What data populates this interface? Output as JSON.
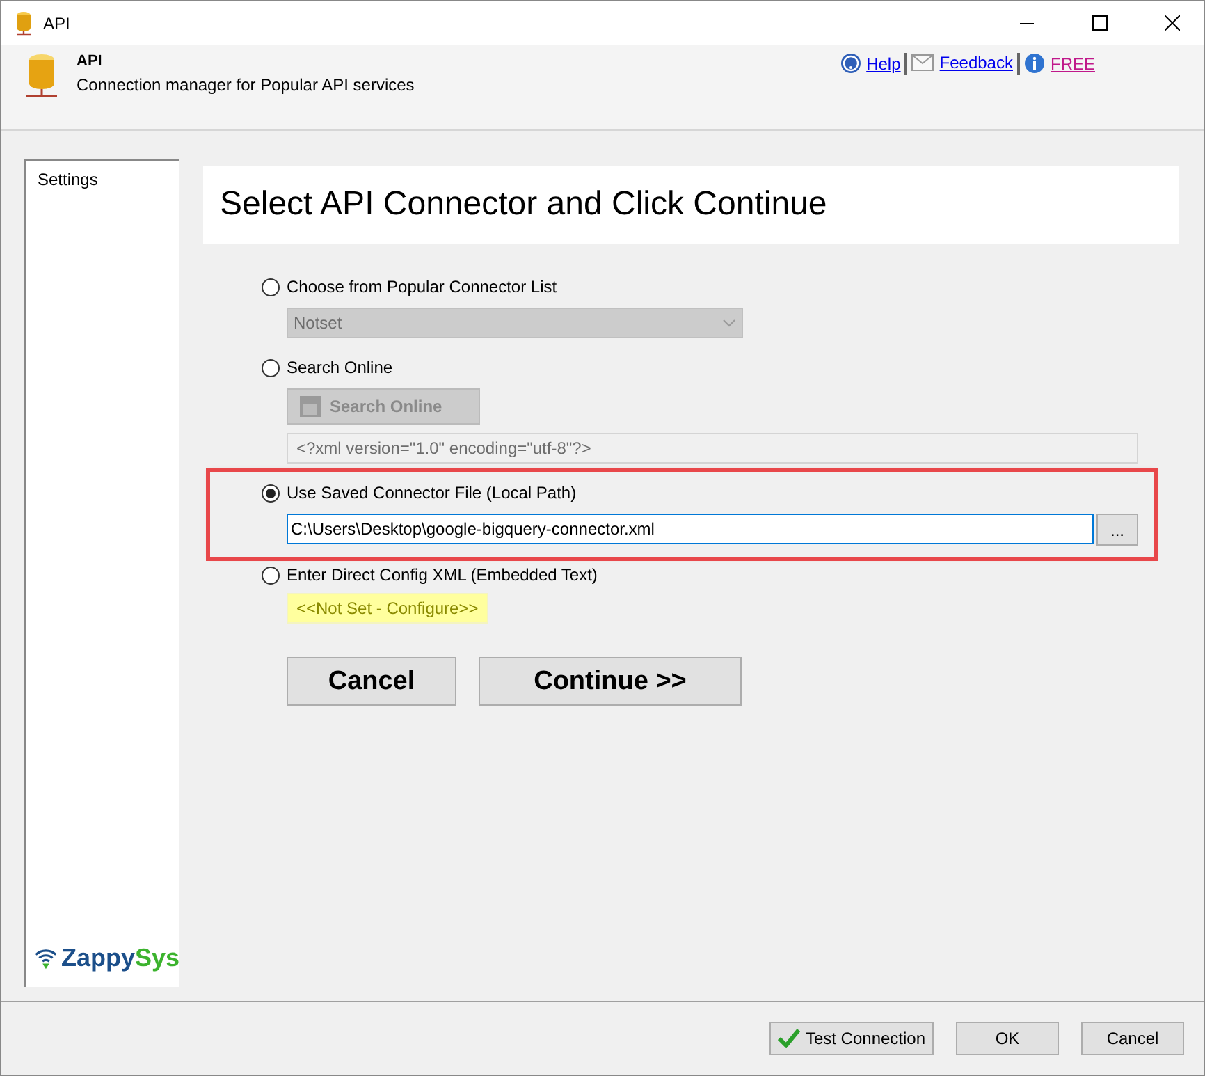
{
  "window": {
    "title": "API"
  },
  "header": {
    "title": "API",
    "subtitle": "Connection manager for Popular API services",
    "links": [
      {
        "kind": "help",
        "label": "Help"
      },
      {
        "kind": "feedback",
        "label": "Feedback"
      },
      {
        "kind": "info",
        "label": "FREE"
      }
    ]
  },
  "sidebar": {
    "items": [
      {
        "label": "Settings",
        "selected": false
      }
    ],
    "logo": {
      "text": "Zappy",
      "accent": "Sys"
    }
  },
  "heading": "Select API Connector and Click Continue",
  "options": [
    {
      "kind": "dropdown",
      "label": "Choose from Popular Connector List",
      "selected": false,
      "highlighted": false,
      "value": "Notset",
      "disabled": true
    },
    {
      "kind": "search",
      "label": "Search Online",
      "selected": false,
      "highlighted": false,
      "button": "Search Online",
      "disabled": true,
      "placeholder": "<?xml version=\"1.0\" encoding=\"utf-8\"?>"
    },
    {
      "kind": "file",
      "label": "Use Saved Connector File (Local Path)",
      "selected": true,
      "highlighted": true,
      "value": "C:\\Users\\Desktop\\google-bigquery-connector.xml",
      "button": "..."
    },
    {
      "kind": "config",
      "label": "Enter Direct Config XML (Embedded Text)",
      "selected": false,
      "highlighted": false,
      "link": "<<Not Set - Configure>>"
    }
  ],
  "actions": [
    "Cancel",
    "Continue >>"
  ],
  "footer": {
    "buttons": [
      {
        "kind": "test",
        "label": "Test Connection"
      },
      {
        "kind": "plain",
        "label": "OK"
      },
      {
        "kind": "plain",
        "label": "Cancel"
      }
    ]
  }
}
